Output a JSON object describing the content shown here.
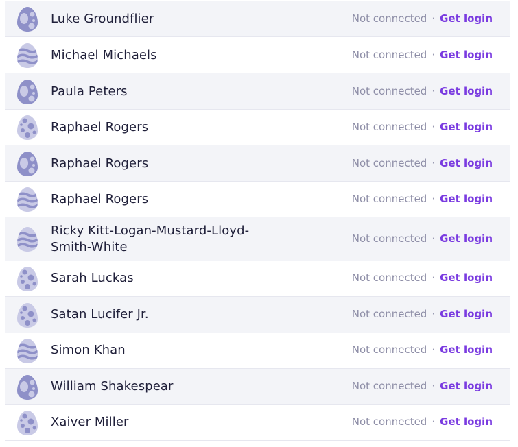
{
  "colors": {
    "row_shade": "#f3f4f8",
    "status_text": "#8e8ea7",
    "login_link": "#7a3be0",
    "egg_base": "#c9cae6",
    "egg_pattern": "#8e90c8"
  },
  "users": [
    {
      "name": "Luke Groundflier",
      "status": "Not connected",
      "separator": "·",
      "action": "Get login",
      "avatar": "egg-big-spots-icon"
    },
    {
      "name": "Michael Michaels",
      "status": "Not connected",
      "separator": "·",
      "action": "Get login",
      "avatar": "egg-waves-icon"
    },
    {
      "name": "Paula Peters",
      "status": "Not connected",
      "separator": "·",
      "action": "Get login",
      "avatar": "egg-big-spots-icon"
    },
    {
      "name": "Raphael Rogers",
      "status": "Not connected",
      "separator": "·",
      "action": "Get login",
      "avatar": "egg-small-spots-icon"
    },
    {
      "name": "Raphael Rogers",
      "status": "Not connected",
      "separator": "·",
      "action": "Get login",
      "avatar": "egg-big-spots-icon"
    },
    {
      "name": "Raphael Rogers",
      "status": "Not connected",
      "separator": "·",
      "action": "Get login",
      "avatar": "egg-waves-icon"
    },
    {
      "name": "Ricky Kitt-Logan-Mustard-Lloyd-Smith-White",
      "status": "Not connected",
      "separator": "·",
      "action": "Get login",
      "avatar": "egg-waves-icon"
    },
    {
      "name": "Sarah Luckas",
      "status": "Not connected",
      "separator": "·",
      "action": "Get login",
      "avatar": "egg-small-spots-icon"
    },
    {
      "name": "Satan Lucifer Jr.",
      "status": "Not connected",
      "separator": "·",
      "action": "Get login",
      "avatar": "egg-small-spots-icon"
    },
    {
      "name": "Simon Khan",
      "status": "Not connected",
      "separator": "·",
      "action": "Get login",
      "avatar": "egg-waves-icon"
    },
    {
      "name": "William Shakespear",
      "status": "Not connected",
      "separator": "·",
      "action": "Get login",
      "avatar": "egg-big-spots-icon"
    },
    {
      "name": "Xaiver Miller",
      "status": "Not connected",
      "separator": "·",
      "action": "Get login",
      "avatar": "egg-small-spots-icon"
    }
  ]
}
